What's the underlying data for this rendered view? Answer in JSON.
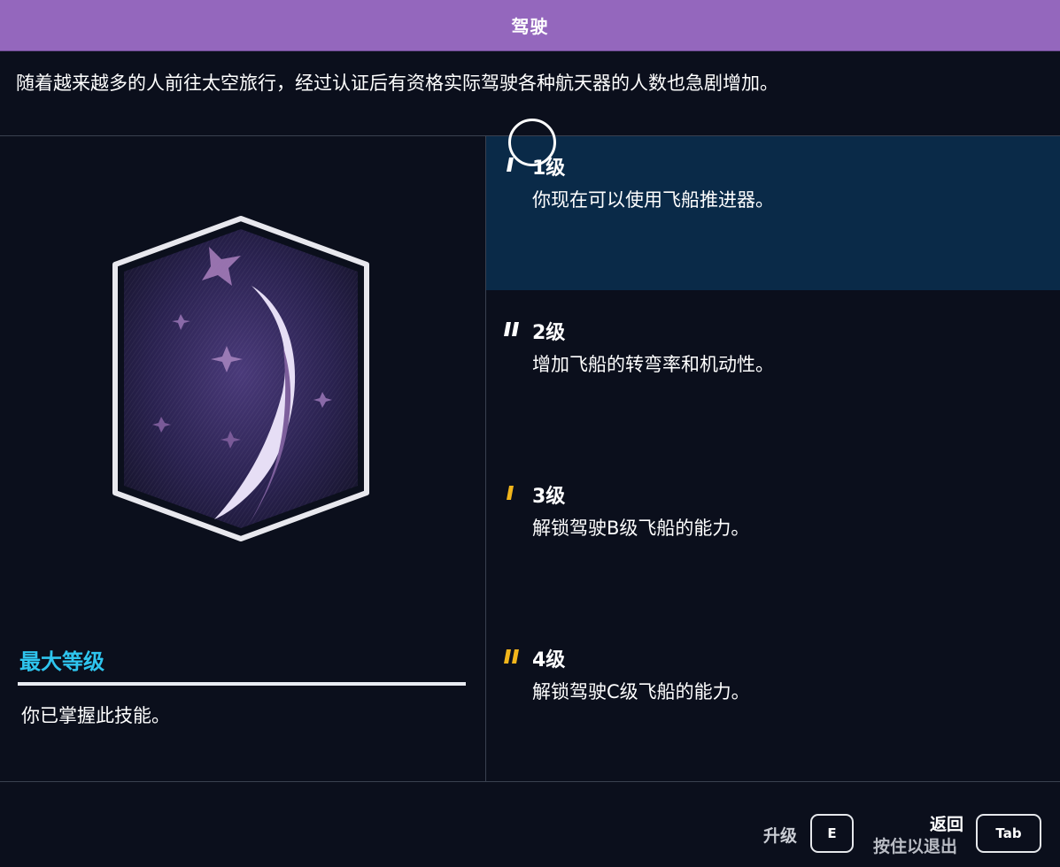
{
  "header": {
    "title": "驾驶"
  },
  "description": "随着越来越多的人前往太空旅行，经过认证后有资格实际驾驶各种航天器的人数也急剧增加。",
  "status": {
    "label": "最大等级",
    "text": "你已掌握此技能。"
  },
  "levels": [
    {
      "title": "1级",
      "desc": "你现在可以使用飞船推进器。"
    },
    {
      "title": "2级",
      "desc": "增加飞船的转弯率和机动性。"
    },
    {
      "title": "3级",
      "desc": "解锁驾驶B级飞船的能力。"
    },
    {
      "title": "4级",
      "desc": "解锁驾驶C级飞船的能力。"
    }
  ],
  "footer": {
    "upgrade_label": "升级",
    "upgrade_key": "E",
    "back_label": "返回",
    "back_hint": "按住以退出",
    "back_key": "Tab"
  },
  "colors": {
    "header_bg": "#9467bd",
    "accent_cyan": "#2ec5ee",
    "selected_bg": "#0a2a48",
    "level_mark_white": "#ffffff",
    "level_mark_gold": "#f2b51b"
  },
  "icons": {
    "badge": "piloting-skill-patch-icon",
    "rank_marks": [
      "rank-1-bar-icon",
      "rank-2-bars-icon",
      "rank-3-bar-icon",
      "rank-4-bars-icon"
    ]
  }
}
